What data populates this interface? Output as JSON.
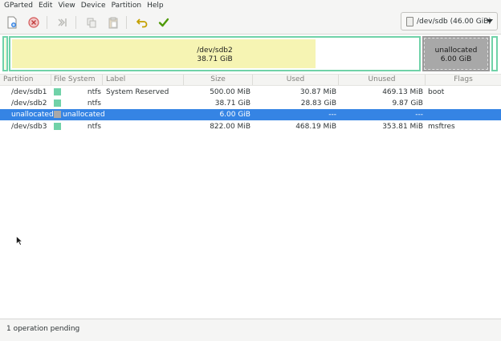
{
  "menu": [
    "GParted",
    "Edit",
    "View",
    "Device",
    "Partition",
    "Help"
  ],
  "toolbar": {
    "icons": [
      "new-partition-icon",
      "delete-icon",
      "resize-move-icon",
      "copy-icon",
      "paste-icon",
      "undo-icon",
      "apply-icon"
    ]
  },
  "device_selector": {
    "label": "/dev/sdb (46.00 GiB)"
  },
  "partition_map": {
    "sdb2": {
      "name": "/dev/sdb2",
      "size": "38.71 GiB"
    },
    "unallocated": {
      "name": "unallocated",
      "size": "6.00 GiB"
    }
  },
  "columns": [
    "Partition",
    "File System",
    "Label",
    "Size",
    "Used",
    "Unused",
    "Flags"
  ],
  "rows": [
    {
      "partition": "/dev/sdb1",
      "fs": "ntfs",
      "label": "System Reserved",
      "size": "500.00 MiB",
      "used": "30.87 MiB",
      "unused": "469.13 MiB",
      "flags": "boot",
      "color": "#70d2a8"
    },
    {
      "partition": "/dev/sdb2",
      "fs": "ntfs",
      "label": "",
      "size": "38.71 GiB",
      "used": "28.83 GiB",
      "unused": "9.87 GiB",
      "flags": "",
      "color": "#70d2a8"
    },
    {
      "partition": "unallocated",
      "fs": "unallocated",
      "label": "",
      "size": "6.00 GiB",
      "used": "---",
      "unused": "---",
      "flags": "",
      "color": "#a8a8a8"
    },
    {
      "partition": "/dev/sdb3",
      "fs": "ntfs",
      "label": "",
      "size": "822.00 MiB",
      "used": "468.19 MiB",
      "unused": "353.81 MiB",
      "flags": "msftres",
      "color": "#70d2a8"
    }
  ],
  "selected_row": 2,
  "status": {
    "text": "1 operation pending"
  },
  "colors": {
    "ntfs": "#70d2a8",
    "unallocated": "#a8a8a8",
    "selection": "#3584e4",
    "used_space": "#f6f4b3"
  }
}
